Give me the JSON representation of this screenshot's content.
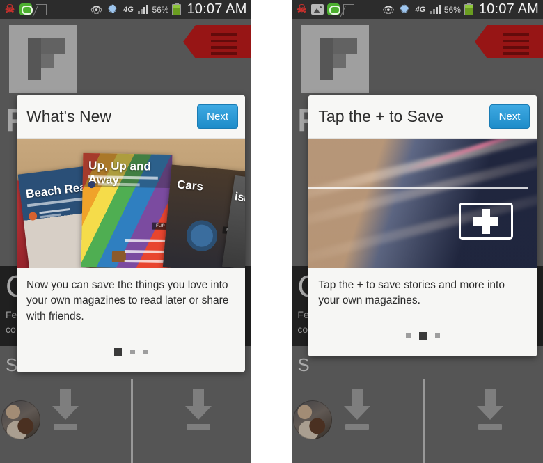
{
  "meta": {
    "app_name": "Flipboard",
    "accent_blue": "#2e9bd6",
    "ribbon_red": "#d81f1f",
    "backdrop_grey": "#7a7a7a"
  },
  "statusbar": {
    "time": "10:07 AM",
    "battery_percent": "56%",
    "network": "4G",
    "icons_left_panel1": [
      "missed-call-icon",
      "message-icon",
      "slash-icon"
    ],
    "icons_left_panel2": [
      "missed-call-icon",
      "gallery-icon",
      "message-icon",
      "slash-icon"
    ],
    "icons_right": [
      "eye-icon",
      "bluetooth-icon",
      "4g-icon",
      "signal-icon",
      "battery-icon"
    ]
  },
  "app": {
    "logo_label": "flipboard-logo",
    "menu_label": "red-ribbon-menu",
    "background_letter": "F",
    "tile_title": "C",
    "tile_sub_line1": "Fe",
    "tile_sub_line2": "co",
    "tile_bottom_letter": "S",
    "download_icon_label": "download-arrow"
  },
  "panels": [
    {
      "id": "panel-left",
      "modal": {
        "title": "What's New",
        "next_label": "Next",
        "body": "Now you can save the things you love into your own magazines to read later or share with friends.",
        "image_kind": "magazine-covers",
        "magazines": [
          {
            "title": "Beach Reads"
          },
          {
            "title": "Up, Up and Away"
          },
          {
            "title": "Cars"
          },
          {
            "title": "ism"
          }
        ],
        "flip_badge": "FLIP",
        "pager": {
          "count": 3,
          "active_index": 0
        }
      }
    },
    {
      "id": "panel-right",
      "modal": {
        "title": "Tap the + to Save",
        "next_label": "Next",
        "body": "Tap the + to save stories and more into your own magazines.",
        "image_kind": "plus-button-photo",
        "plus_label": "+",
        "pager": {
          "count": 3,
          "active_index": 1
        }
      }
    }
  ]
}
